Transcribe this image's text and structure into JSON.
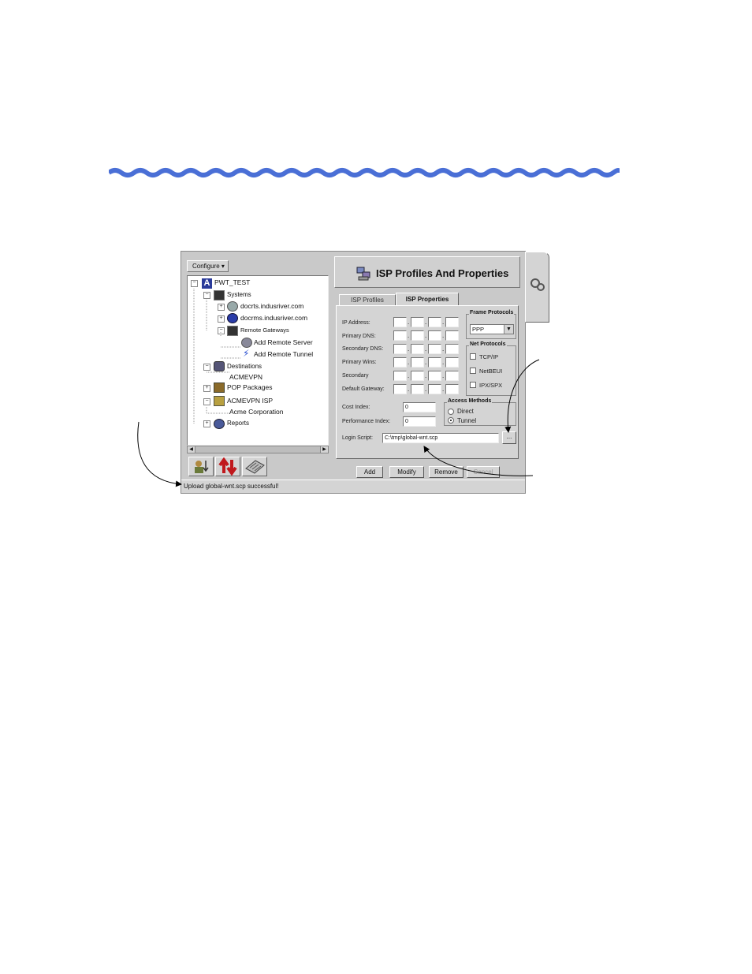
{
  "configure_button": "Configure",
  "tree": {
    "root": "PWT_TEST",
    "systems": "Systems",
    "server1": "docrts.indusriver.com",
    "server2": "docrms.indusriver.com",
    "remote_gateways": "Remote Gateways",
    "add_remote_server": "Add Remote Server",
    "add_remote_tunnel": "Add Remote Tunnel",
    "destinations": "Destinations",
    "acmevpn": "ACMEVPN",
    "pop_packages": "POP Packages",
    "acmevpn_isp": "ACMEVPN ISP",
    "acme_corp": "Acme Corporation",
    "reports": "Reports"
  },
  "panel": {
    "title": "ISP Profiles And Properties",
    "tabs": [
      "ISP Profiles",
      "ISP Properties"
    ],
    "active_tab": "ISP Properties",
    "fields": [
      "IP Address:",
      "Primary DNS:",
      "Secondary DNS:",
      "Primary Wins:",
      "Secondary",
      "Default Gateway:"
    ],
    "frame_protocols": {
      "label": "Frame Protocols",
      "selected": "PPP"
    },
    "net_protocols": {
      "label": "Net Protocols",
      "options": [
        "TCP/IP",
        "NetBEUI",
        "IPX/SPX"
      ]
    },
    "cost_index": {
      "label": "Cost Index:",
      "value": "0"
    },
    "performance_index": {
      "label": "Performance Index:",
      "value": "0"
    },
    "access_methods": {
      "label": "Access Methods",
      "options": [
        "Direct",
        "Tunnel"
      ],
      "selected": "Tunnel"
    },
    "login_script": {
      "label": "Login Script:",
      "value": "C:\\tmp\\global-wnt.scp"
    },
    "browse": "...",
    "buttons": {
      "add": "Add",
      "modify": "Modify",
      "remove": "Remove",
      "cancel": "Cancel"
    }
  },
  "status": "Upload global-wnt.scp successful!",
  "colors": {
    "wave": "#4a6fd6",
    "window_bg": "#d4d4d4"
  }
}
